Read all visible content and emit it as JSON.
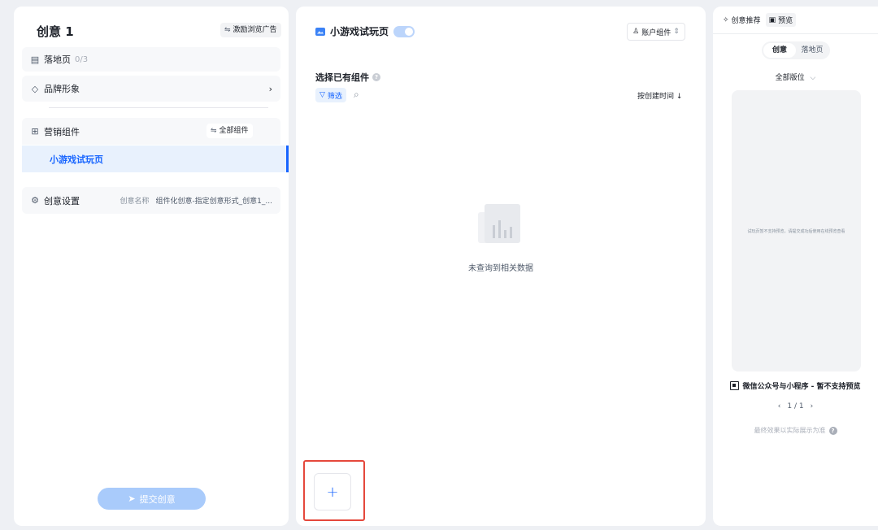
{
  "left": {
    "title": "创意 1",
    "incentive_chip": "激励浏览广告",
    "landing": {
      "label": "落地页",
      "count": "0/3"
    },
    "brand": {
      "label": "品牌形象"
    },
    "marketing": {
      "label": "营销组件",
      "all_chip": "全部组件"
    },
    "selected_item": "小游戏试玩页",
    "settings": {
      "label": "创意设置",
      "name_key": "创意名称",
      "name_value": "组件化创意-指定创意形式_创意1_..."
    },
    "submit": "提交创意"
  },
  "middle": {
    "title": "小游戏试玩页",
    "toggle_on": true,
    "account_btn": "账户组件",
    "select_label": "选择已有组件",
    "filter": "筛选",
    "sort": "按创建时间",
    "empty_text": "未查询到相关数据",
    "add": "+"
  },
  "right": {
    "recommend": "创意推荐",
    "preview": "预览",
    "seg": [
      "创意",
      "落地页"
    ],
    "seg_active": 0,
    "placement": "全部版位",
    "phone_note": "试玩页暂不支持预览，请提交成功后使用在线预览查看",
    "mini_label": "微信公众号与小程序 - 暂不支持预览",
    "pager": "1 / 1",
    "final_note": "最终效果以实际展示为准"
  }
}
